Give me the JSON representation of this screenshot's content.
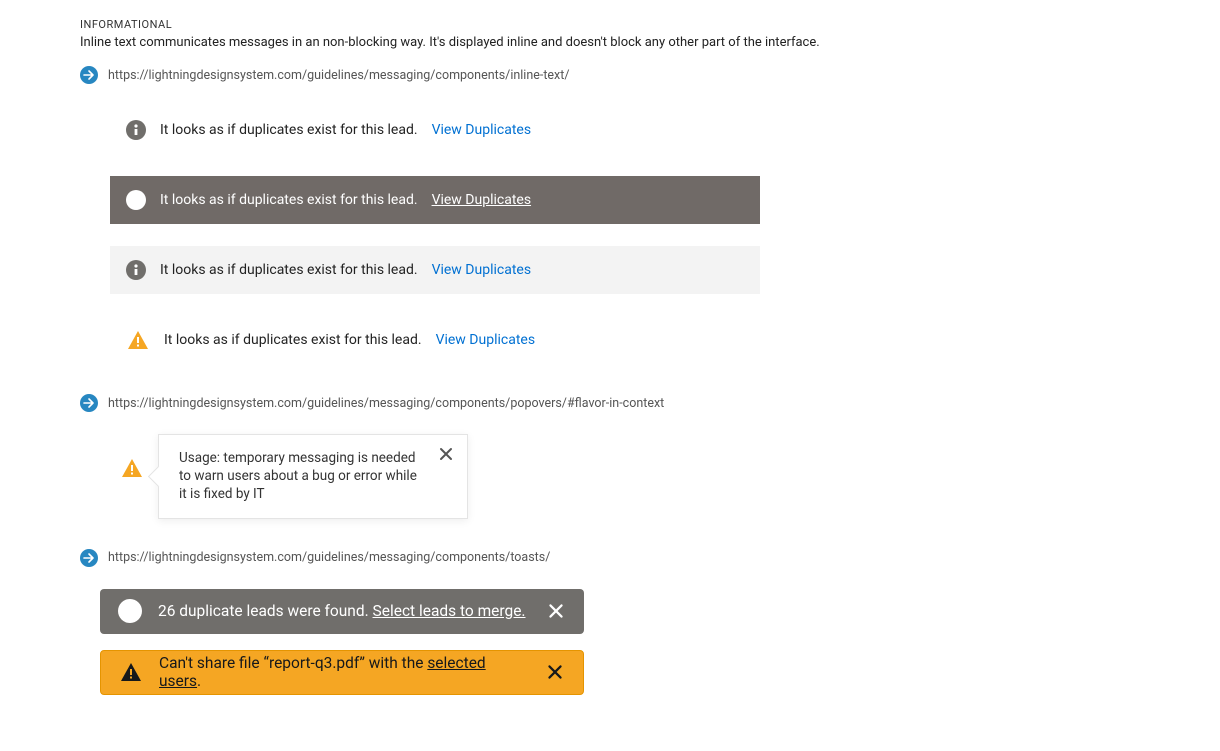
{
  "section": {
    "heading": "INFORMATIONAL",
    "description": "Inline text communicates messages in an non-blocking way. It's displayed inline and doesn't block any other part of the interface."
  },
  "links": {
    "inline_text": "https://lightningdesignsystem.com/guidelines/messaging/components/inline-text/",
    "popovers": "https://lightningdesignsystem.com/guidelines/messaging/components/popovers/#flavor-in-context",
    "toasts": "https://lightningdesignsystem.com/guidelines/messaging/components/toasts/"
  },
  "inline_examples": [
    {
      "variant": "plain-info",
      "message": "It looks as if duplicates exist for this lead.",
      "action": "View Duplicates"
    },
    {
      "variant": "dark-info",
      "message": "It looks as if duplicates exist for this lead.",
      "action": "View Duplicates"
    },
    {
      "variant": "light-info",
      "message": "It looks as if duplicates exist for this lead.",
      "action": "View Duplicates"
    },
    {
      "variant": "plain-warn",
      "message": "It looks as if duplicates exist for this lead.",
      "action": "View Duplicates"
    }
  ],
  "popover": {
    "body": "Usage: temporary messaging is needed to warn users about a bug or error while it is fixed by IT"
  },
  "toasts": [
    {
      "variant": "info",
      "text": "26 duplicate leads were found. ",
      "link": "Select leads to merge."
    },
    {
      "variant": "warning",
      "text": "Can't share file “report-q3.pdf” with the ",
      "link": "selected users",
      "suffix": "."
    }
  ],
  "colors": {
    "arrow_badge": "#2787c1",
    "info_icon_bg": "#706e6b",
    "dark_row_bg": "#706a67",
    "light_row_bg": "#f3f3f3",
    "action_link": "#0070d2",
    "warning_fill": "#f5a623",
    "toast_grey": "#706e6b",
    "toast_orange": "#f5a623"
  }
}
